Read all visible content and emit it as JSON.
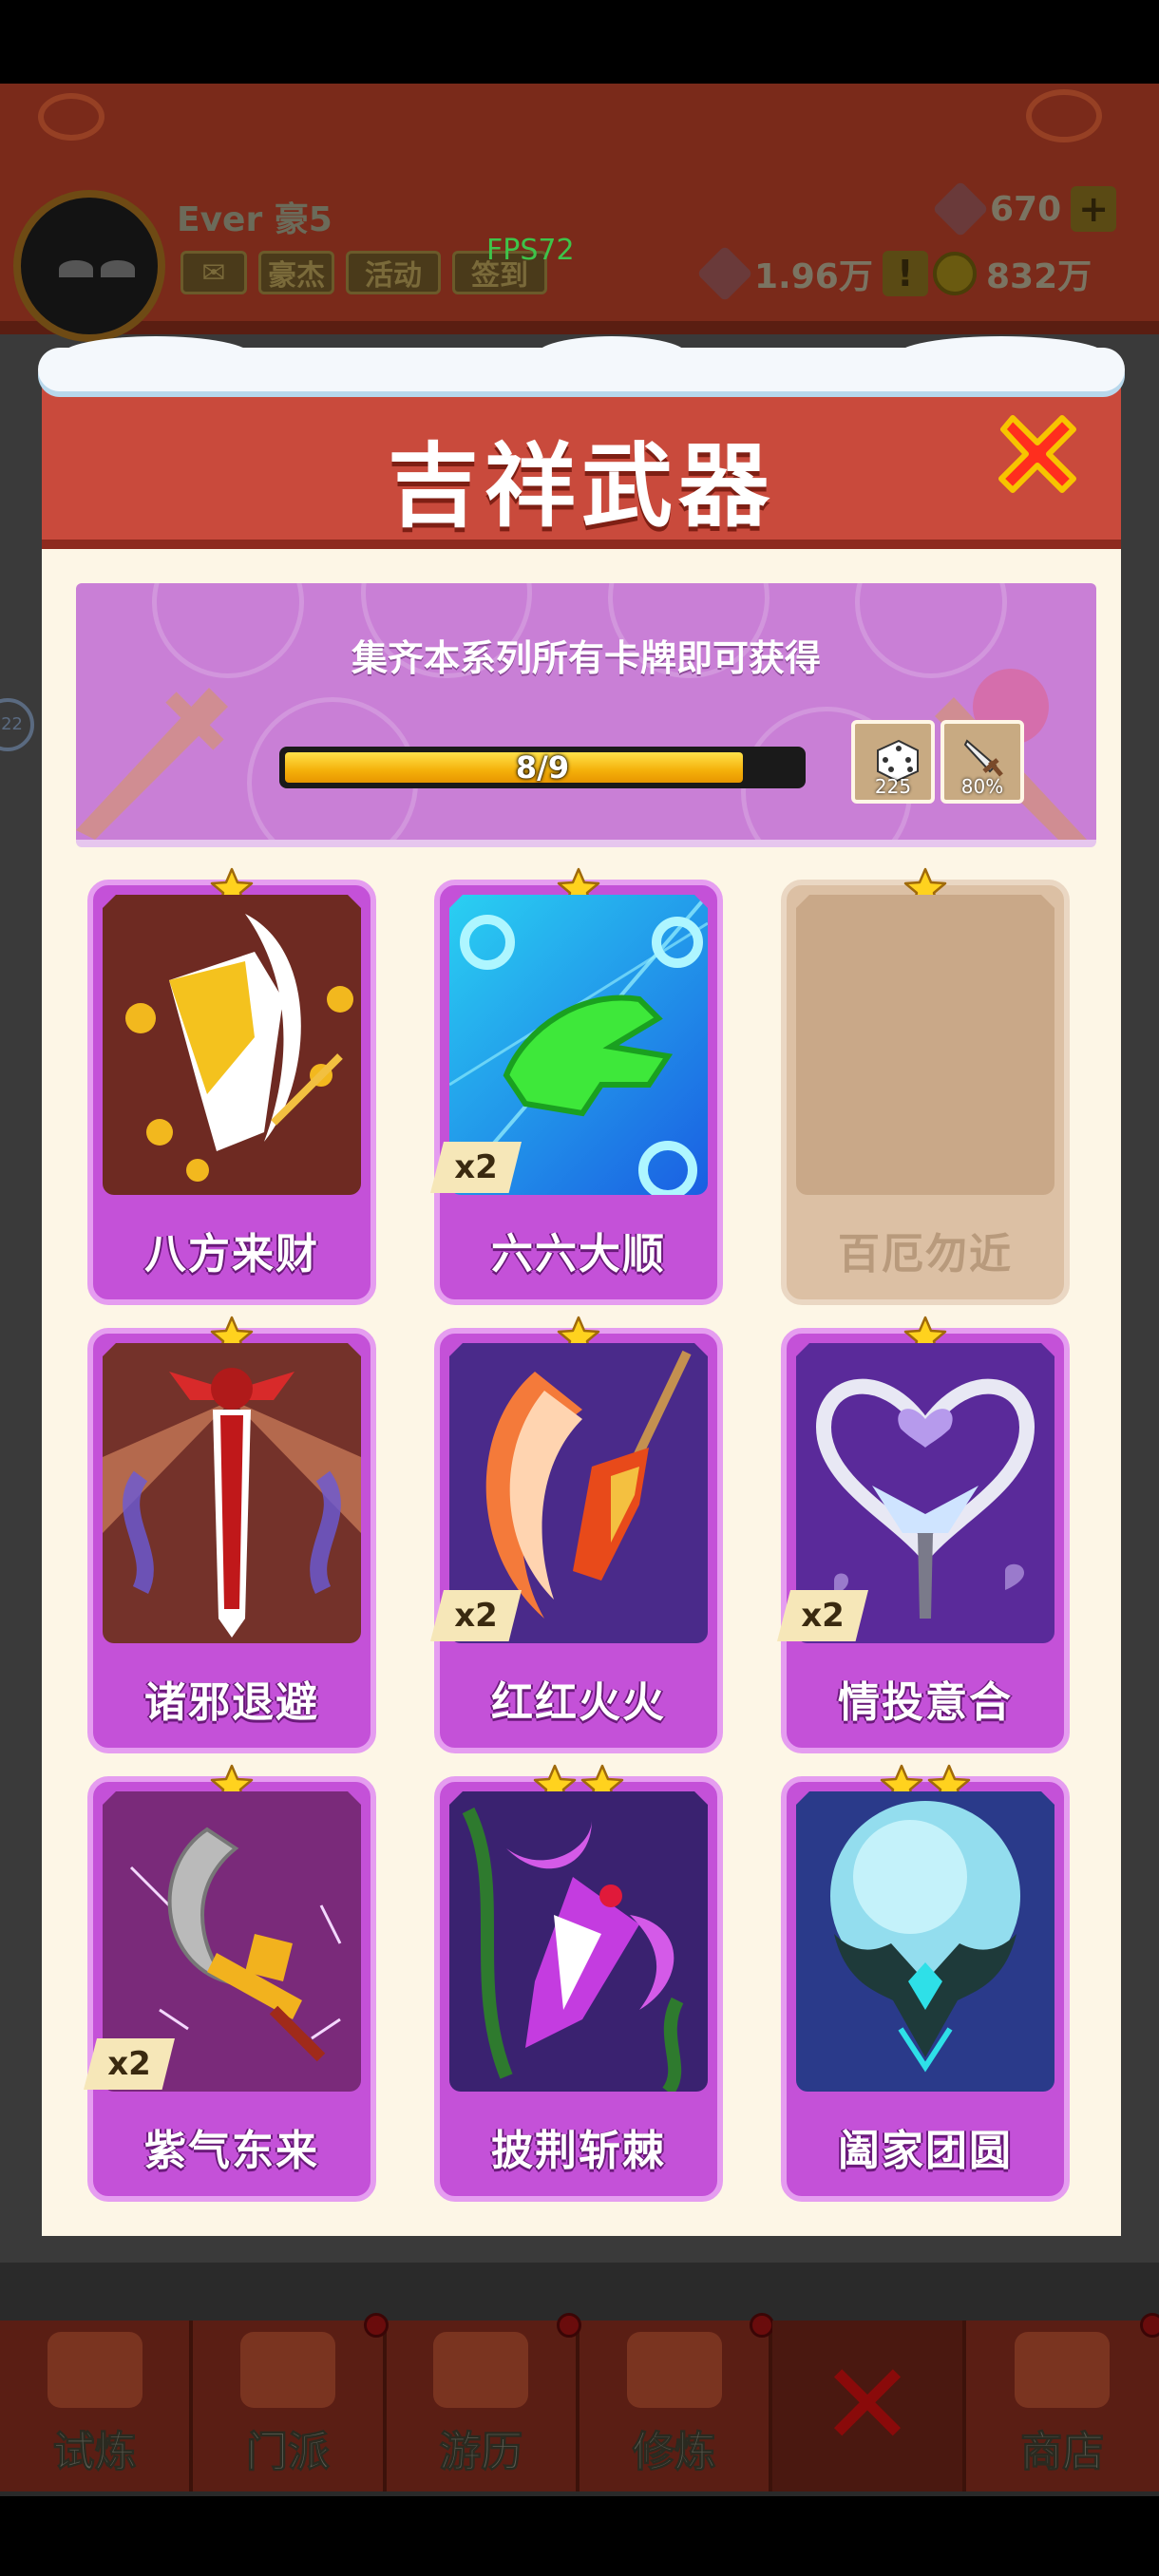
{
  "hud": {
    "player_name": "Ever 豪5",
    "fps": "FPS72",
    "chips": [
      "豪杰",
      "活动",
      "签到"
    ],
    "gems": "670",
    "tokens": "1.96万",
    "coins": "832万",
    "side_bubble": "22"
  },
  "bottom_nav": {
    "tabs": [
      "试炼",
      "门派",
      "游历",
      "修炼",
      "",
      "商店"
    ]
  },
  "dialog": {
    "title": "吉祥武器",
    "close_icon": "close-x-icon"
  },
  "banner": {
    "text": "集齐本系列所有卡牌即可获得",
    "progress_label": "8/9",
    "progress_current": 8,
    "progress_total": 9,
    "rewards": [
      {
        "icon": "dice-icon",
        "value": "225"
      },
      {
        "icon": "sword-icon",
        "value": "80%"
      }
    ]
  },
  "cards": [
    {
      "name": "八方来财",
      "stars": 1,
      "qty": "",
      "owned": true,
      "art": "gold-ingot-blade"
    },
    {
      "name": "六六大顺",
      "stars": 1,
      "qty": "x2",
      "owned": true,
      "art": "green-hand-blue"
    },
    {
      "name": "百厄勿近",
      "stars": 1,
      "qty": "",
      "owned": false,
      "art": "locked"
    },
    {
      "name": "诸邪退避",
      "stars": 1,
      "qty": "",
      "owned": true,
      "art": "red-sword"
    },
    {
      "name": "红红火火",
      "stars": 1,
      "qty": "x2",
      "owned": true,
      "art": "fire-crescent-spear"
    },
    {
      "name": "情投意合",
      "stars": 1,
      "qty": "x2",
      "owned": true,
      "art": "heart-staff"
    },
    {
      "name": "紫气东来",
      "stars": 1,
      "qty": "x2",
      "owned": true,
      "art": "silver-crescent-blade"
    },
    {
      "name": "披荆斩棘",
      "stars": 2,
      "qty": "",
      "owned": true,
      "art": "purple-thorn-blade"
    },
    {
      "name": "阖家团圆",
      "stars": 2,
      "qty": "",
      "owned": true,
      "art": "moon-orb-antler"
    }
  ],
  "colors": {
    "card_purple": "#c451d8",
    "header_red": "#c94a3c",
    "panel_cream": "#fdf6e6",
    "banner_lilac": "#c97fd6",
    "progress_yellow": "#f4b00a"
  }
}
